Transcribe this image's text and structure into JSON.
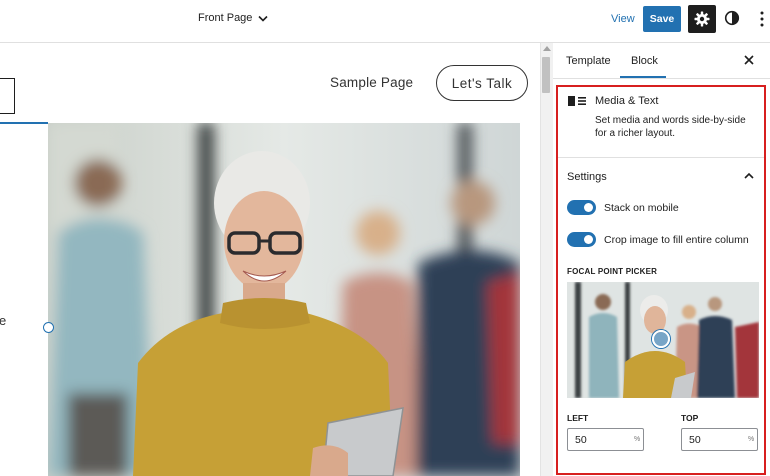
{
  "topbar": {
    "document_title": "Front Page",
    "view_label": "View",
    "save_label": "Save"
  },
  "canvas": {
    "nav_link": "Sample Page",
    "cta_button": "Let's  Talk",
    "edge_text": "e"
  },
  "sidebar": {
    "tabs": [
      {
        "label": "Template"
      },
      {
        "label": "Block",
        "active": true
      }
    ],
    "block": {
      "title": "Media & Text",
      "description": "Set media and words side-by-side for a richer layout."
    },
    "settings": {
      "heading": "Settings",
      "stack_on_mobile": {
        "label": "Stack on mobile",
        "checked": true
      },
      "crop_image": {
        "label": "Crop image to fill entire column",
        "checked": true
      }
    },
    "focal_point": {
      "label": "FOCAL POINT PICKER",
      "left_label": "LEFT",
      "left_value": "50",
      "top_label": "TOP",
      "top_value": "50",
      "unit": "%"
    }
  },
  "colors": {
    "accent": "#2271b1",
    "highlight": "#d71f1f",
    "dark": "#1e1e1e"
  }
}
